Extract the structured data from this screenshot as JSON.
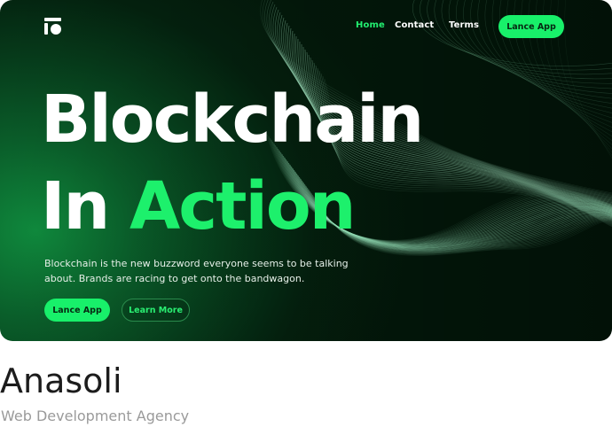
{
  "hero": {
    "nav": {
      "home": "Home",
      "contact": "Contact",
      "terms": "Terms",
      "cta": "Lance App"
    },
    "headline_line1": "Blockchain",
    "headline_line2_plain": "In ",
    "headline_line2_accent": "Action",
    "description_line1": "Blockchain is the new buzzword everyone seems to be talking",
    "description_line2": "about. Brands are racing to get onto the bandwagon.",
    "primary_button": "Lance App",
    "secondary_button": "Learn More"
  },
  "project": {
    "title": "Anasoli",
    "subtitle": "Web Development Agency"
  },
  "colors": {
    "accent": "#1df06c",
    "background_dark": "#031a0b",
    "background_green": "#0f8a3d"
  }
}
